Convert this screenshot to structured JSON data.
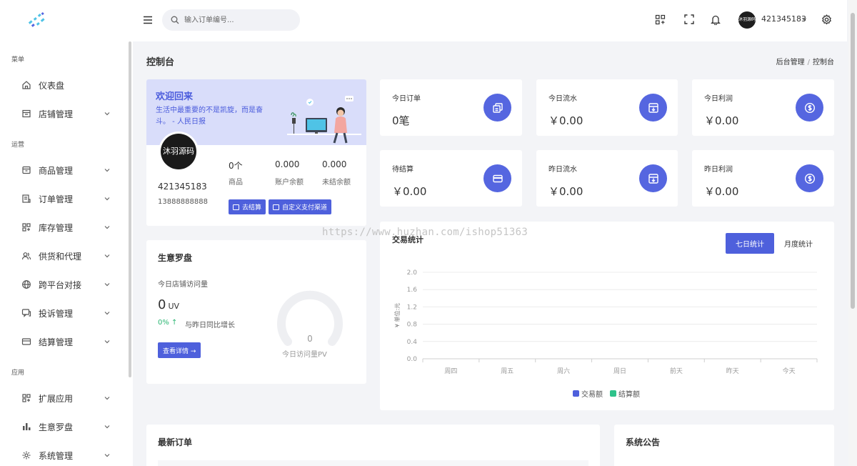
{
  "sidebar": {
    "sections": [
      "菜单",
      "运营",
      "应用"
    ],
    "items": [
      {
        "label": "仪表盘",
        "icon": "home-icon"
      },
      {
        "label": "店铺管理",
        "icon": "store-icon"
      },
      {
        "label": "商品管理",
        "icon": "box-icon"
      },
      {
        "label": "订单管理",
        "icon": "order-icon"
      },
      {
        "label": "库存管理",
        "icon": "grid-icon"
      },
      {
        "label": "供货和代理",
        "icon": "users-icon"
      },
      {
        "label": "跨平台对接",
        "icon": "globe-icon"
      },
      {
        "label": "投诉管理",
        "icon": "chat-icon"
      },
      {
        "label": "结算管理",
        "icon": "card-icon"
      },
      {
        "label": "扩展应用",
        "icon": "apps-icon"
      },
      {
        "label": "生意罗盘",
        "icon": "bar-chart-icon"
      },
      {
        "label": "系统管理",
        "icon": "gear-icon"
      }
    ]
  },
  "topbar": {
    "search_placeholder": "输入订单编号...",
    "user_name": "421345183",
    "avatar_text": "沐羽源码"
  },
  "page": {
    "title": "控制台",
    "breadcrumb": [
      "后台管理",
      "控制台"
    ]
  },
  "welcome": {
    "title": "欢迎回来",
    "quote": "生活中最重要的不是凯旋，而是奋斗。 - 人民日报",
    "avatar_text": "沐羽源码",
    "user": "421345183",
    "phone": "13888888888",
    "stats": [
      {
        "value": "0个",
        "label": "商品"
      },
      {
        "value": "0.000",
        "label": "账户余额"
      },
      {
        "value": "0.000",
        "label": "未结余额"
      }
    ],
    "btn_settle": "去结算",
    "btn_custom": "自定义支付渠道"
  },
  "stat_cards": [
    {
      "title": "今日订单",
      "value": "0笔",
      "icon": "copy-icon"
    },
    {
      "title": "今日流水",
      "value": "￥0.00",
      "icon": "inbox-icon"
    },
    {
      "title": "今日利润",
      "value": "￥0.00",
      "icon": "dollar-icon"
    },
    {
      "title": "待结算",
      "value": "￥0.00",
      "icon": "card-icon"
    },
    {
      "title": "昨日流水",
      "value": "￥0.00",
      "icon": "inbox-icon"
    },
    {
      "title": "昨日利润",
      "value": "￥0.00",
      "icon": "dollar-icon"
    }
  ],
  "compass": {
    "title": "生意罗盘",
    "visits_label": "今日店铺访问量",
    "uv_value": "0",
    "uv_unit": "UV",
    "pct": "0% ↑",
    "compare": "与昨日同比增长",
    "btn": "查看详情 →",
    "gauge_value": "0",
    "gauge_label": "今日访问量PV"
  },
  "trade": {
    "title": "交易统计",
    "tab_week": "七日统计",
    "tab_month": "月度统计"
  },
  "chart_data": {
    "type": "bar",
    "categories": [
      "周四",
      "周五",
      "周六",
      "周日",
      "前天",
      "昨天",
      "今天"
    ],
    "series": [
      {
        "name": "交易额",
        "values": [
          0,
          0,
          0,
          0,
          0,
          0,
          0
        ],
        "color": "#4e60dc"
      },
      {
        "name": "结算额",
        "values": [
          0,
          0,
          0,
          0,
          0,
          0,
          0
        ],
        "color": "#2ec28a"
      }
    ],
    "ylabel": "¥ 单位:元",
    "ylim": [
      0,
      2.0
    ],
    "yticks": [
      "0.0",
      "0.4",
      "0.8",
      "1.2",
      "1.6",
      "2.0"
    ],
    "grid": true,
    "legend": "bottom-center"
  },
  "latest_orders": {
    "title": "最新订单"
  },
  "notice": {
    "title": "系统公告"
  },
  "watermark": "https://www.huzhan.com/ishop51363",
  "colors": {
    "accent": "#4e60dc",
    "success": "#2ec28a"
  }
}
